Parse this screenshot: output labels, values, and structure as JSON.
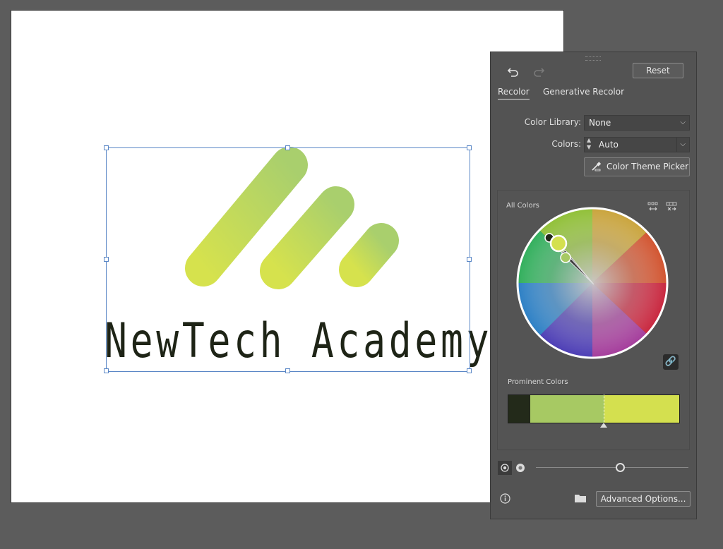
{
  "artboard": {
    "logo_text": "NewTech Academy",
    "logo_colors": {
      "light": "#d4e04f",
      "mid": "#b3d36a",
      "dark": "#1e2416"
    }
  },
  "panel": {
    "reset_label": "Reset",
    "tabs": [
      {
        "label": "Recolor",
        "active": true
      },
      {
        "label": "Generative Recolor",
        "active": false
      }
    ],
    "color_library": {
      "label": "Color Library:",
      "value": "None"
    },
    "colors": {
      "label": "Colors:",
      "value": "Auto"
    },
    "theme_picker_label": "Color Theme Picker",
    "all_colors_label": "All Colors",
    "prominent_label": "Prominent Colors",
    "prominent_colors": [
      {
        "color": "#232a1a",
        "share": 0.13
      },
      {
        "color": "#a7c963",
        "share": 0.43
      },
      {
        "color": "#d4e04f",
        "share": 0.44
      }
    ],
    "saturation_slider": 0.55,
    "advanced_options_label": "Advanced Options...",
    "icons": [
      "undo-icon",
      "redo-icon",
      "eyedropper-icon",
      "link-icon",
      "info-icon",
      "folder-icon",
      "color-wheel-icon",
      "color-bars-icon"
    ]
  }
}
